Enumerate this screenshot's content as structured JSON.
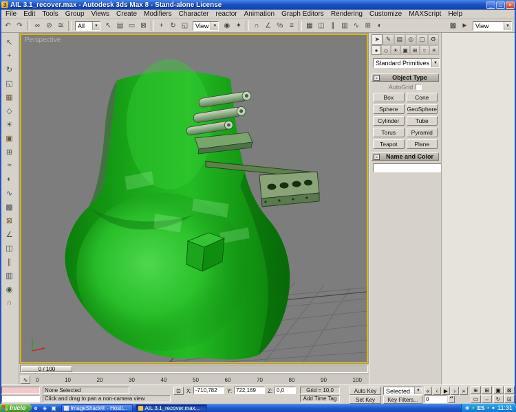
{
  "window": {
    "title": "AIL 3.1_recover.max - Autodesk 3ds Max 8 - Stand-alone License"
  },
  "menu_items": [
    "File",
    "Edit",
    "Tools",
    "Group",
    "Views",
    "Create",
    "Modifiers",
    "Character",
    "reactor",
    "Animation",
    "Graph Editors",
    "Rendering",
    "Customize",
    "MAXScript",
    "Help"
  ],
  "toolbar": {
    "selection_filter_value": "All",
    "ref_coord_value": "View",
    "render_type_value": "View"
  },
  "viewport": {
    "label": "Perspective"
  },
  "command_panel": {
    "dropdown_value": "Standard Primitives",
    "rollout_object_type": "Object Type",
    "autogrid_label": "AutoGrid",
    "object_buttons": [
      "Box",
      "Cone",
      "Sphere",
      "GeoSphere",
      "Cylinder",
      "Tube",
      "Torus",
      "Pyramid",
      "Teapot",
      "Plane"
    ],
    "rollout_name_color": "Name and Color",
    "name_value": "",
    "swatch_color": "#8c1538"
  },
  "timeline": {
    "slider_label": "0 / 100",
    "ticks": [
      "0",
      "10",
      "20",
      "30",
      "40",
      "50",
      "60",
      "70",
      "80",
      "90",
      "100"
    ]
  },
  "status": {
    "selection": "None Selected",
    "prompt": "Click and drag to pan a non-camera view",
    "x_label": "X:",
    "y_label": "Y:",
    "z_label": "Z:",
    "x_value": "-710,782",
    "y_value": "722,169",
    "z_value": "0,0",
    "grid_value": "Grid = 10,0",
    "add_time_tag": "Add Time Tag"
  },
  "anim": {
    "auto_key": "Auto Key",
    "set_key": "Set Key",
    "key_mode_value": "Selected",
    "key_filters": "Key Filters...",
    "frame": "0"
  },
  "taskbar": {
    "start_label": "Inicio",
    "tasks": [
      {
        "label": "ImageShack® - Hosti..."
      },
      {
        "label": "AIL 3.1_recover.max..."
      }
    ],
    "lang": "ES",
    "clock": "11:31"
  },
  "colors": {
    "model_green": "#1aa81a",
    "viewport_bg": "#7d7d7d",
    "active_viewport_border": "#dcb613"
  },
  "left_toolbar_icons": [
    "↖",
    "+",
    "↻",
    "◱",
    "▦",
    "◇",
    "☀",
    "▣",
    "⊞",
    "≈",
    "◐",
    "∿",
    "▩",
    "⊠",
    "∠",
    "◫",
    "∥",
    "▥",
    "◉",
    "∩"
  ],
  "icons": {
    "app": "3",
    "minimize": "_",
    "maximize": "□",
    "close": "×",
    "dropdown": "▼",
    "collapse": "-",
    "undo": "↶",
    "redo": "↷",
    "select_link": "∞",
    "unlink": "⊘",
    "bind_spacewarp": "≋",
    "select_object": "↖",
    "select_by_name": "▤",
    "rect_region": "▭",
    "crossing": "⊠",
    "move": "+",
    "rotate": "↻",
    "scale": "◱",
    "use_center": "◉",
    "manipulate": "✦",
    "snap": "∩",
    "angle_snap": "∠",
    "percent_snap": "%",
    "spinner_snap": "≡",
    "named_sel": "▦",
    "mirror": "◫",
    "align": "∥",
    "layers": "▥",
    "curve_editor": "∿",
    "schematic": "⊞",
    "material": "◐",
    "render_scene": "▩",
    "quick_render": "►",
    "tab_create": "➤",
    "tab_modify": "✎",
    "tab_hierarchy": "▤",
    "tab_motion": "◎",
    "tab_display": "▢",
    "tab_utilities": "⚙",
    "cat_geometry": "●",
    "cat_shapes": "◇",
    "cat_lights": "☀",
    "cat_cameras": "▣",
    "cat_helpers": "⊞",
    "cat_spacewarps": "≈",
    "cat_systems": "✳",
    "lock": "⊡",
    "go_start": "«",
    "prev_key": "‹",
    "play": "▶",
    "next_key": "›",
    "go_end": "»",
    "spin": "▴▾",
    "zoom": "⊕",
    "zoom_all": "⊞",
    "zoom_extents": "▣",
    "zoom_extents_all": "⊠",
    "region_zoom": "▭",
    "pan": "⇔",
    "arc_rotate": "↻",
    "max_toggle": "⊡",
    "mini_curve": "∿",
    "ql1": "e",
    "ql2": "◈",
    "ql3": "▣",
    "tray1": "◉",
    "tray2": "♦",
    "tray3": "▪",
    "tray4": "●"
  }
}
